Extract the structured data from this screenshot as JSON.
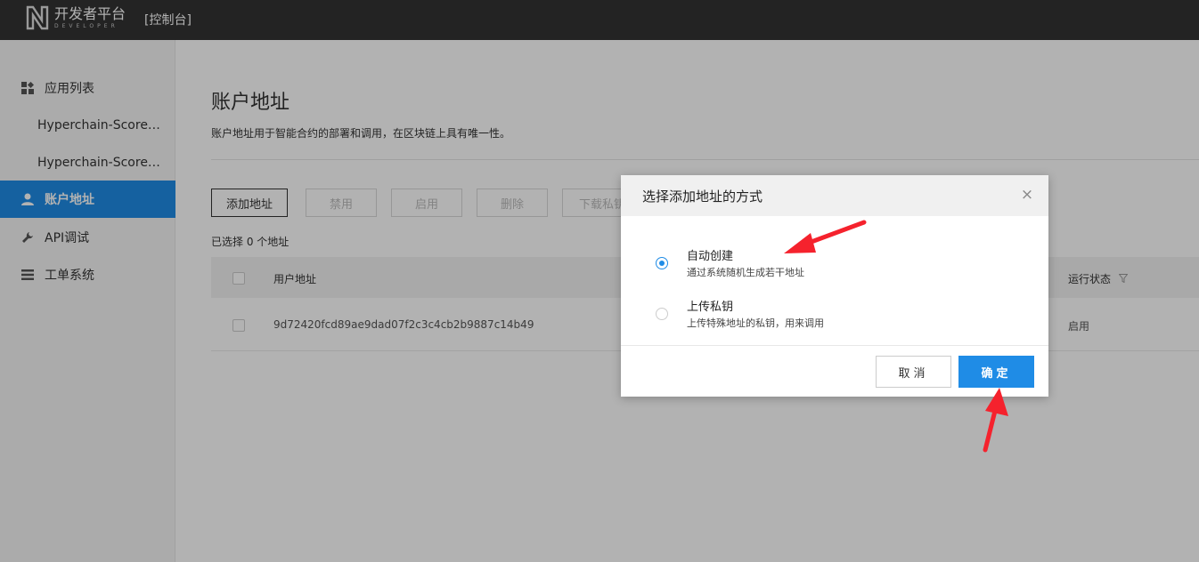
{
  "header": {
    "brand_title": "开发者平台",
    "brand_sub": "DEVELOPER",
    "console_tag": "[控制台]"
  },
  "sidebar": {
    "items": [
      {
        "label": "应用列表",
        "icon": "apps-grid-icon"
      },
      {
        "label": "Hyperchain-Score…"
      },
      {
        "label": "Hyperchain-Score…"
      },
      {
        "label": "账户地址",
        "icon": "user-icon",
        "active": true
      },
      {
        "label": "API调试",
        "icon": "wrench-icon"
      },
      {
        "label": "工单系统",
        "icon": "list-icon"
      }
    ]
  },
  "main": {
    "title": "账户地址",
    "description": "账户地址用于智能合约的部署和调用，在区块链上具有唯一性。",
    "buttons": {
      "add": "添加地址",
      "disable": "禁用",
      "enable": "启用",
      "delete": "删除",
      "download": "下载私钥"
    },
    "selected_info": "已选择 0 个地址",
    "table": {
      "headers": {
        "address": "用户地址",
        "status": "运行状态"
      },
      "rows": [
        {
          "address": "9d72420fcd89ae9dad07f2c3c4cb2b9887c14b49",
          "status": "启用"
        }
      ]
    }
  },
  "modal": {
    "title": "选择添加地址的方式",
    "options": [
      {
        "label": "自动创建",
        "desc": "通过系统随机生成若干地址",
        "checked": true
      },
      {
        "label": "上传私钥",
        "desc": "上传特殊地址的私钥，用来调用",
        "checked": false
      }
    ],
    "cancel_label": "取消",
    "ok_label": "确定"
  },
  "colors": {
    "accent": "#1f8ce6",
    "topbar": "#333333",
    "annotation_arrow": "#f5222d"
  }
}
